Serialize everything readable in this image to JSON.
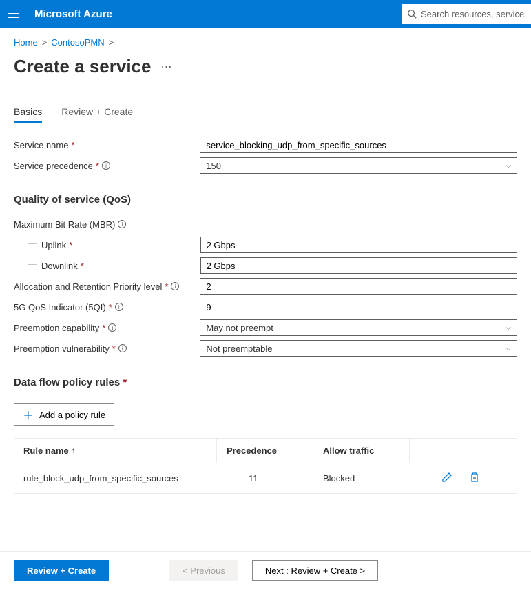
{
  "header": {
    "brand": "Microsoft Azure",
    "search_placeholder": "Search resources, services, and docs"
  },
  "breadcrumb": {
    "items": [
      "Home",
      "ContosoPMN"
    ]
  },
  "page": {
    "title": "Create a service"
  },
  "tabs": {
    "basics": "Basics",
    "review": "Review + Create"
  },
  "form": {
    "service_name_label": "Service name",
    "service_name_value": "service_blocking_udp_from_specific_sources",
    "service_precedence_label": "Service precedence",
    "service_precedence_value": "150",
    "qos_section": "Quality of service (QoS)",
    "mbr_label": "Maximum Bit Rate (MBR)",
    "uplink_label": "Uplink",
    "uplink_value": "2 Gbps",
    "downlink_label": "Downlink",
    "downlink_value": "2 Gbps",
    "arp_label": "Allocation and Retention Priority level",
    "arp_value": "2",
    "qi_label": "5G QoS Indicator (5QI)",
    "qi_value": "9",
    "prec_label": "Preemption capability",
    "prec_value": "May not preempt",
    "prev_label": "Preemption vulnerability",
    "prev_value": "Not preemptable",
    "dataflow_section": "Data flow policy rules",
    "add_rule": "Add a policy rule"
  },
  "table": {
    "col_rule": "Rule name",
    "col_precedence": "Precedence",
    "col_allow": "Allow traffic",
    "rows": [
      {
        "name": "rule_block_udp_from_specific_sources",
        "precedence": "11",
        "allow": "Blocked"
      }
    ]
  },
  "footer": {
    "review": "Review + Create",
    "previous": "< Previous",
    "next": "Next : Review + Create >"
  }
}
